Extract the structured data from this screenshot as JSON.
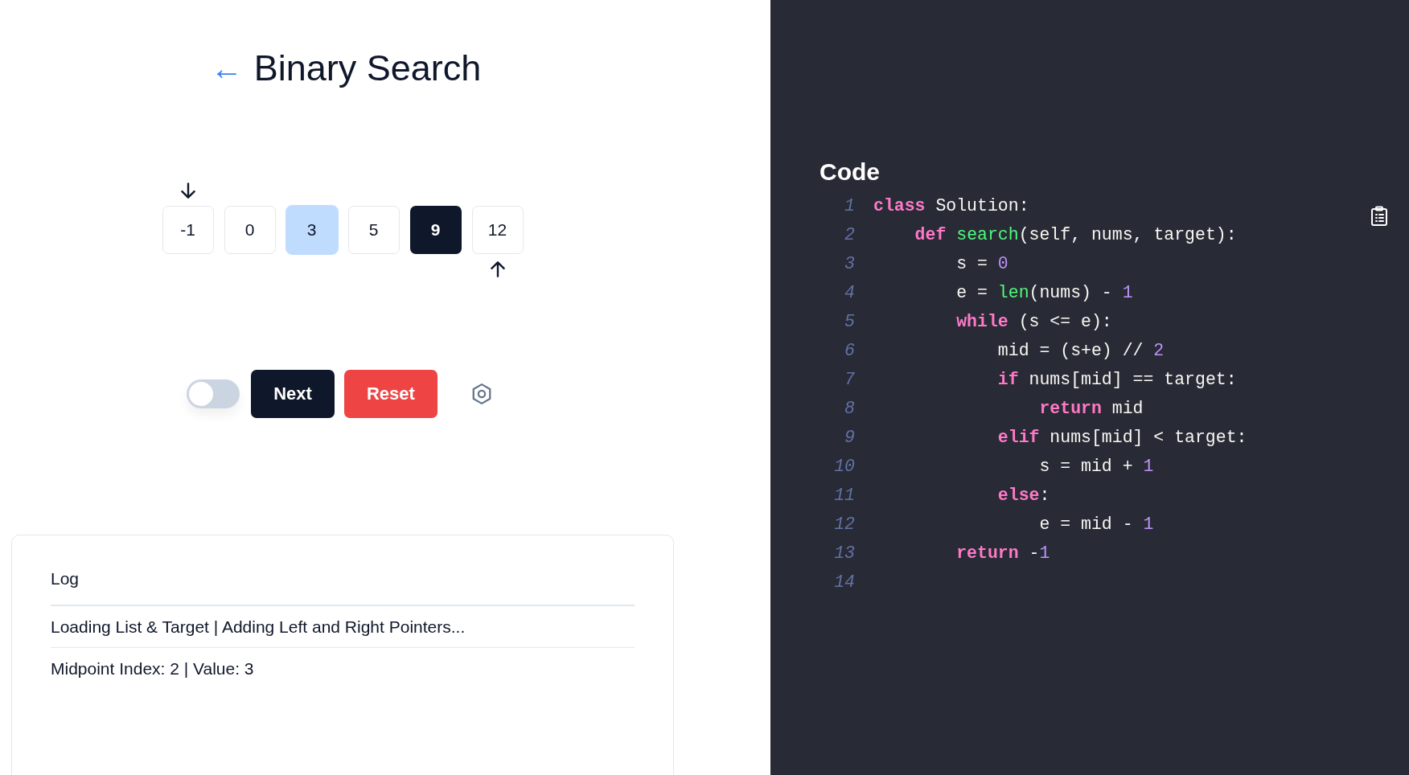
{
  "header": {
    "back_icon": "←",
    "title": "Binary Search"
  },
  "array": [
    {
      "value": "-1",
      "midpoint": false,
      "target": false,
      "pointer_above": true,
      "pointer_below": false
    },
    {
      "value": "0",
      "midpoint": false,
      "target": false,
      "pointer_above": false,
      "pointer_below": false
    },
    {
      "value": "3",
      "midpoint": true,
      "target": false,
      "pointer_above": false,
      "pointer_below": false
    },
    {
      "value": "5",
      "midpoint": false,
      "target": false,
      "pointer_above": false,
      "pointer_below": false
    },
    {
      "value": "9",
      "midpoint": false,
      "target": true,
      "pointer_above": false,
      "pointer_below": false
    },
    {
      "value": "12",
      "midpoint": false,
      "target": false,
      "pointer_above": false,
      "pointer_below": true
    }
  ],
  "controls": {
    "toggle": {
      "on": false
    },
    "buttons": [
      {
        "label": "Next",
        "kind": "primary"
      },
      {
        "label": "Reset",
        "kind": "danger"
      }
    ]
  },
  "log": {
    "title": "Log",
    "entries": [
      "Loading List & Target | Adding Left and Right Pointers...",
      "Midpoint Index: 2 | Value: 3"
    ]
  },
  "code": {
    "title": "Code",
    "lines": [
      {
        "number": "1",
        "tokens": [
          {
            "kind": "keyword",
            "text": "class"
          },
          {
            "kind": "plain",
            "text": " Solution:"
          }
        ]
      },
      {
        "number": "2",
        "tokens": [
          {
            "kind": "keyword",
            "text": "    def"
          },
          {
            "kind": "function",
            "text": " search"
          },
          {
            "kind": "plain",
            "text": "(self, nums, target):"
          }
        ]
      },
      {
        "number": "3",
        "tokens": [
          {
            "kind": "plain",
            "text": "        s = "
          },
          {
            "kind": "number",
            "text": "0"
          }
        ]
      },
      {
        "number": "4",
        "tokens": [
          {
            "kind": "plain",
            "text": "        e = "
          },
          {
            "kind": "function",
            "text": "len"
          },
          {
            "kind": "plain",
            "text": "(nums) - "
          },
          {
            "kind": "number",
            "text": "1"
          }
        ]
      },
      {
        "number": "5",
        "tokens": [
          {
            "kind": "keyword",
            "text": "        while"
          },
          {
            "kind": "plain",
            "text": " (s <= e):"
          }
        ]
      },
      {
        "number": "6",
        "tokens": [
          {
            "kind": "plain",
            "text": "            mid = (s+e) // "
          },
          {
            "kind": "number",
            "text": "2"
          }
        ]
      },
      {
        "number": "7",
        "tokens": [
          {
            "kind": "keyword",
            "text": "            if"
          },
          {
            "kind": "plain",
            "text": " nums[mid] == target:"
          }
        ]
      },
      {
        "number": "8",
        "tokens": [
          {
            "kind": "keyword",
            "text": "                return"
          },
          {
            "kind": "plain",
            "text": " mid"
          }
        ]
      },
      {
        "number": "9",
        "tokens": [
          {
            "kind": "keyword",
            "text": "            elif"
          },
          {
            "kind": "plain",
            "text": " nums[mid] < target:"
          }
        ]
      },
      {
        "number": "10",
        "tokens": [
          {
            "kind": "plain",
            "text": "                s = mid + "
          },
          {
            "kind": "number",
            "text": "1"
          }
        ]
      },
      {
        "number": "11",
        "tokens": [
          {
            "kind": "keyword",
            "text": "            else"
          },
          {
            "kind": "plain",
            "text": ":"
          }
        ]
      },
      {
        "number": "12",
        "tokens": [
          {
            "kind": "plain",
            "text": "                e = mid - "
          },
          {
            "kind": "number",
            "text": "1"
          }
        ]
      },
      {
        "number": "13",
        "tokens": [
          {
            "kind": "keyword",
            "text": "        return"
          },
          {
            "kind": "plain",
            "text": " -"
          },
          {
            "kind": "number",
            "text": "1"
          }
        ]
      },
      {
        "number": "14"
      }
    ]
  }
}
